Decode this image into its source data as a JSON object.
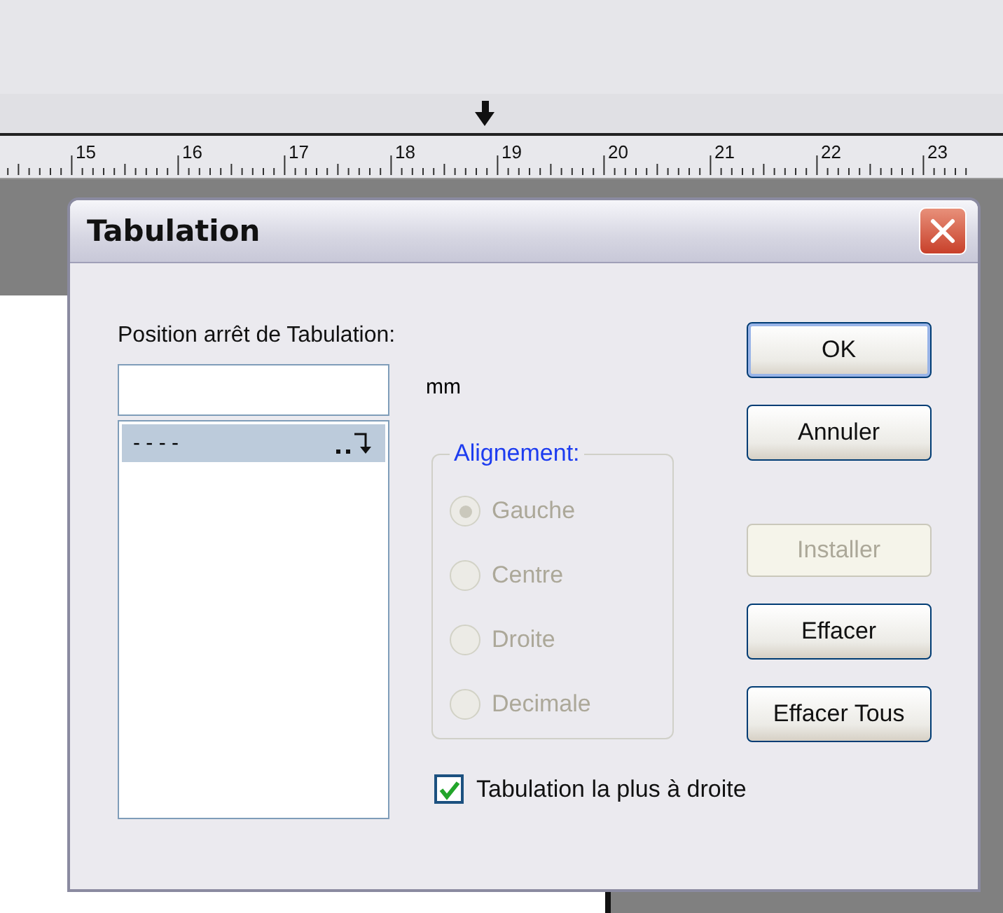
{
  "ruler": {
    "labels": [
      "15",
      "16",
      "17",
      "18",
      "19",
      "20",
      "21",
      "22",
      "23"
    ]
  },
  "dialog": {
    "title": "Tabulation",
    "position_label": "Position arrêt de Tabulation:",
    "unit": "mm",
    "tab_list": [
      {
        "label": "- - - -",
        "selected": true
      }
    ],
    "alignment": {
      "legend": "Alignement:",
      "disabled": true,
      "options": [
        {
          "label": "Gauche",
          "selected": true
        },
        {
          "label": "Centre",
          "selected": false
        },
        {
          "label": "Droite",
          "selected": false
        },
        {
          "label": "Decimale",
          "selected": false
        }
      ]
    },
    "buttons": [
      {
        "label": "OK",
        "default": true,
        "disabled": false
      },
      {
        "label": "Annuler",
        "default": false,
        "disabled": false
      },
      {
        "label": "Installer",
        "default": false,
        "disabled": true
      },
      {
        "label": "Effacer",
        "default": false,
        "disabled": false
      },
      {
        "label": "Effacer Tous",
        "default": false,
        "disabled": false
      }
    ],
    "checkbox": {
      "label": "Tabulation la plus à droite",
      "checked": true
    }
  }
}
